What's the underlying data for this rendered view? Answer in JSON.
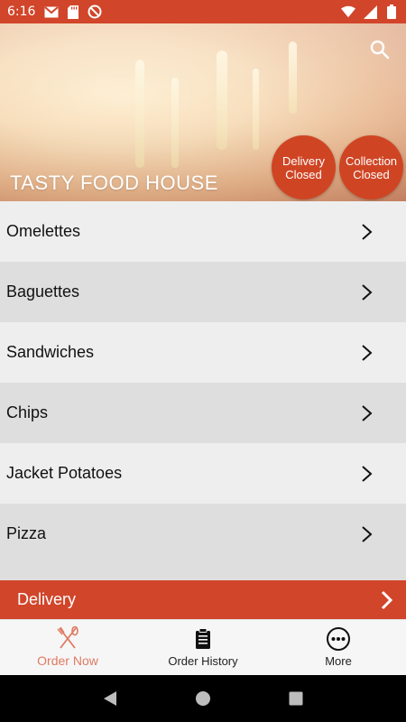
{
  "status_bar": {
    "time": "6:16",
    "icons_left": [
      "gmail-icon",
      "sd-card-icon",
      "do-not-disturb-icon"
    ],
    "icons_right": [
      "wifi-icon",
      "signal-icon",
      "battery-icon"
    ]
  },
  "hero": {
    "title": "TASTY FOOD HOUSE",
    "search_icon": "search-icon",
    "delivery_status": {
      "line1": "Delivery",
      "line2": "Closed"
    },
    "collection_status": {
      "line1": "Collection",
      "line2": "Closed"
    }
  },
  "menu": {
    "items": [
      {
        "label": "Omelettes"
      },
      {
        "label": "Baguettes"
      },
      {
        "label": "Sandwiches"
      },
      {
        "label": "Chips"
      },
      {
        "label": "Jacket Potatoes"
      },
      {
        "label": "Pizza"
      }
    ]
  },
  "delivery_bar": {
    "label": "Delivery"
  },
  "bottom_nav": {
    "items": [
      {
        "label": "Order Now",
        "icon": "fork-knife-icon",
        "active": true
      },
      {
        "label": "Order History",
        "icon": "clipboard-icon",
        "active": false
      },
      {
        "label": "More",
        "icon": "more-dots-icon",
        "active": false
      }
    ]
  },
  "colors": {
    "brand": "#d1452a",
    "active_nav": "#e07a62",
    "row_light": "#eeeeee",
    "row_dark": "#dedede"
  }
}
